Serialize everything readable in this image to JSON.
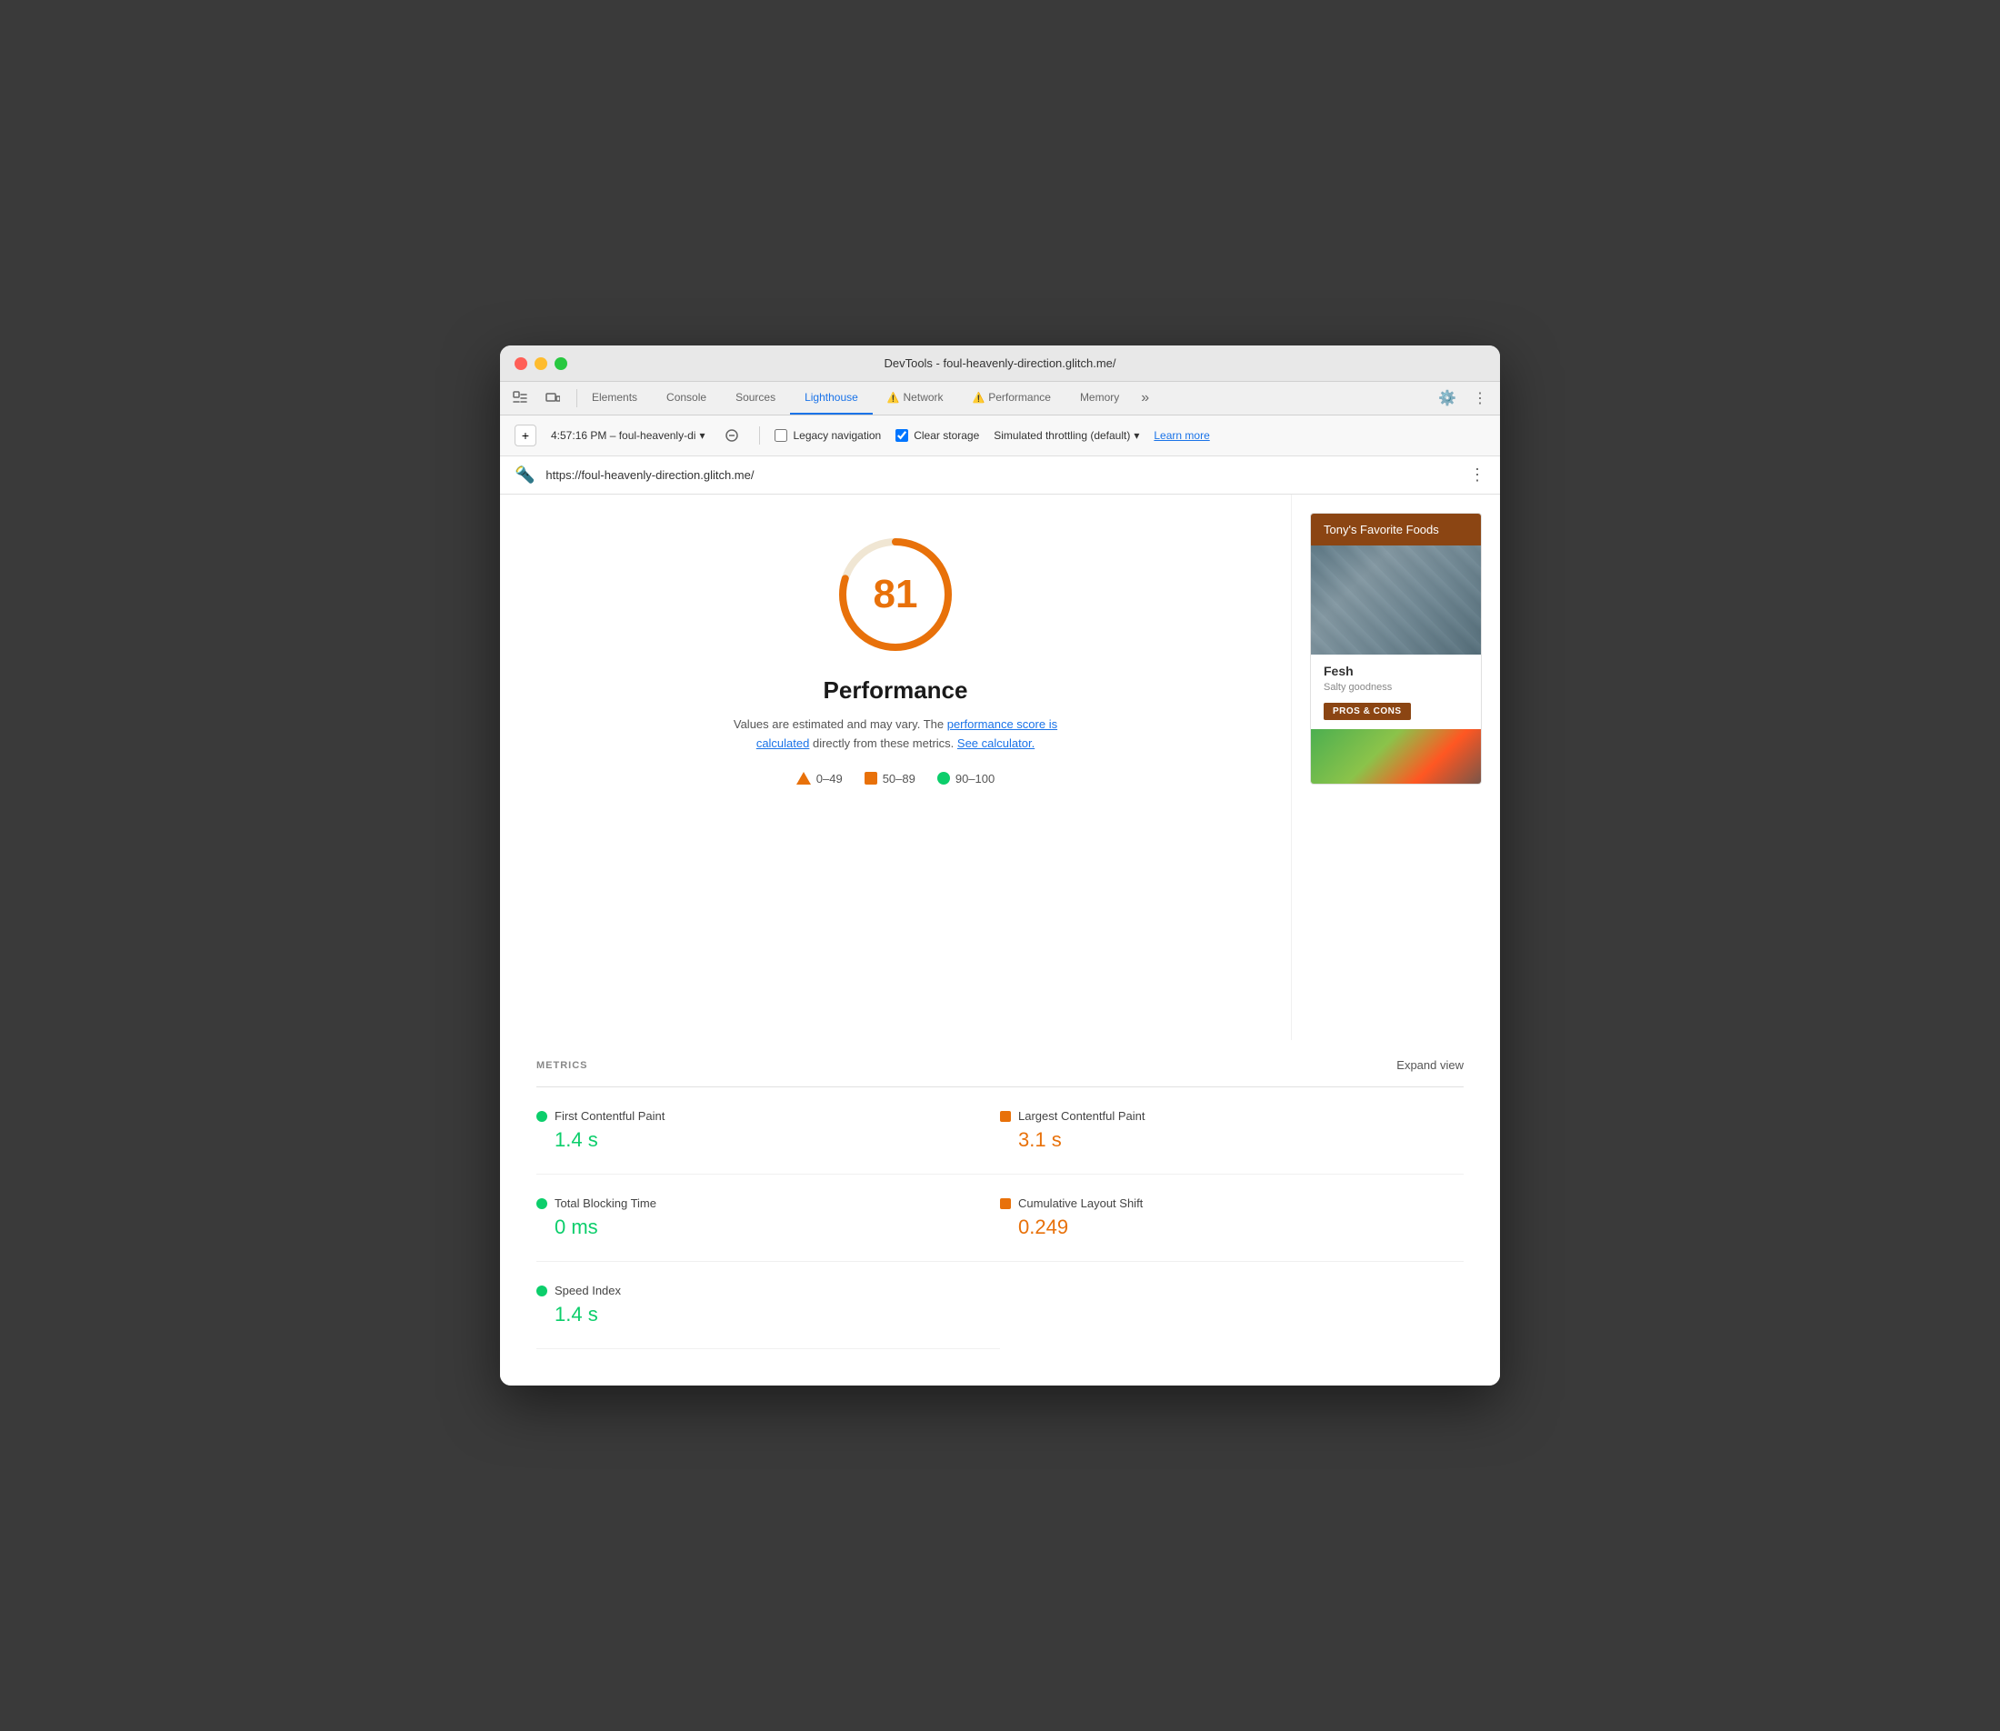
{
  "window": {
    "title": "DevTools - foul-heavenly-direction.glitch.me/"
  },
  "tabs": {
    "elements": "Elements",
    "console": "Console",
    "sources": "Sources",
    "lighthouse": "Lighthouse",
    "network": "Network",
    "performance": "Performance",
    "memory": "Memory",
    "more": "»"
  },
  "toolbar": {
    "session": "4:57:16 PM – foul-heavenly-di",
    "legacy_nav_label": "Legacy navigation",
    "clear_storage_label": "Clear storage",
    "throttle_label": "Simulated throttling (default)",
    "learn_more": "Learn more"
  },
  "url_bar": {
    "url": "https://foul-heavenly-direction.glitch.me/"
  },
  "score": {
    "value": "81",
    "label": "Performance",
    "subtitle_plain": "Values are estimated and may vary. The ",
    "link1": "performance score is calculated",
    "subtitle_mid": " directly from these metrics. ",
    "link2": "See calculator.",
    "legend": [
      {
        "type": "triangle",
        "range": "0–49"
      },
      {
        "type": "square",
        "range": "50–89"
      },
      {
        "type": "circle",
        "range": "90–100"
      }
    ]
  },
  "preview": {
    "header": "Tony's Favorite Foods",
    "item_title": "Fesh",
    "item_subtitle": "Salty goodness",
    "button": "PROS & CONS"
  },
  "metrics": {
    "section_label": "METRICS",
    "expand_label": "Expand view",
    "items": [
      {
        "name": "First Contentful Paint",
        "value": "1.4 s",
        "color": "green",
        "indicator": "circle"
      },
      {
        "name": "Largest Contentful Paint",
        "value": "3.1 s",
        "color": "orange",
        "indicator": "square"
      },
      {
        "name": "Total Blocking Time",
        "value": "0 ms",
        "color": "green",
        "indicator": "circle"
      },
      {
        "name": "Cumulative Layout Shift",
        "value": "0.249",
        "color": "orange",
        "indicator": "square"
      },
      {
        "name": "Speed Index",
        "value": "1.4 s",
        "color": "green",
        "indicator": "circle"
      }
    ]
  }
}
